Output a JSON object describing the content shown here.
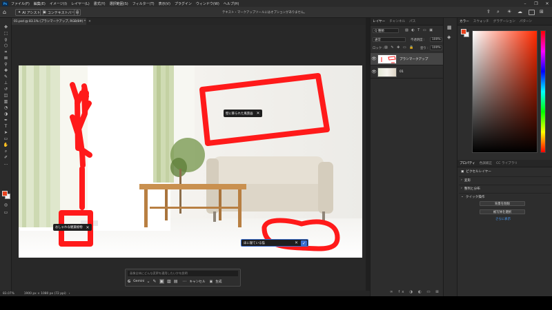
{
  "app": {
    "logo": "Ps"
  },
  "menu": {
    "items": [
      "ファイル(F)",
      "編集(E)",
      "イメージ(I)",
      "レイヤー(L)",
      "書式(Y)",
      "選択範囲(S)",
      "フィルター(T)",
      "表示(V)",
      "プラグイン",
      "ウィンドウ(W)",
      "ヘルプ(H)"
    ]
  },
  "options": {
    "ai_assist": "AI アシスト",
    "contextual": "コンテキストバー",
    "hint": "テキスト・マークアップツールにはオプションがありません。"
  },
  "document": {
    "tab": "01.psd @ 83.1% (プランマークアップ, RGB/8#) *"
  },
  "canvas": {
    "labels": {
      "wall": "壁に飾られた風景画",
      "plant": "おしゃれな観葉植物",
      "floor": "床に寝ている猫"
    }
  },
  "taskbar": {
    "prompt": "画像全体にどんな変更を適用したいかを説明",
    "model": "Gemini",
    "cancel": "キャンセル",
    "generate": "生成"
  },
  "status": {
    "zoom": "83.07%",
    "dims": "1900 px × 1080 px (72 ppi)"
  },
  "layers_panel": {
    "tabs": [
      "レイヤー",
      "チャンネル",
      "パス"
    ],
    "filter": "Q 種類",
    "blend_mode": "通常",
    "opacity_label": "不透明度 :",
    "opacity": "100%",
    "lock_label": "ロック :",
    "fill_label": "塗り :",
    "fill": "100%",
    "layers": [
      {
        "name": "プランマークアップ"
      },
      {
        "name": "01"
      }
    ]
  },
  "color_panel": {
    "tabs": [
      "カラー",
      "スウォッチ",
      "グラデーション",
      "パターン"
    ]
  },
  "properties_panel": {
    "tabs": [
      "プロパティ",
      "色調補正",
      "CC ライブラリ"
    ],
    "layer_type": "ピクセルレイヤー",
    "sections": [
      "変形",
      "整列と分布",
      "クイック操作"
    ],
    "quick_actions": [
      "背景を削除",
      "被写体を選択"
    ],
    "more": "さらに表示"
  },
  "colors": {
    "accent": "#31a8ff",
    "markup": "#ff1a1a",
    "foreground": "#e8421d",
    "background": "#f0f0f0"
  }
}
